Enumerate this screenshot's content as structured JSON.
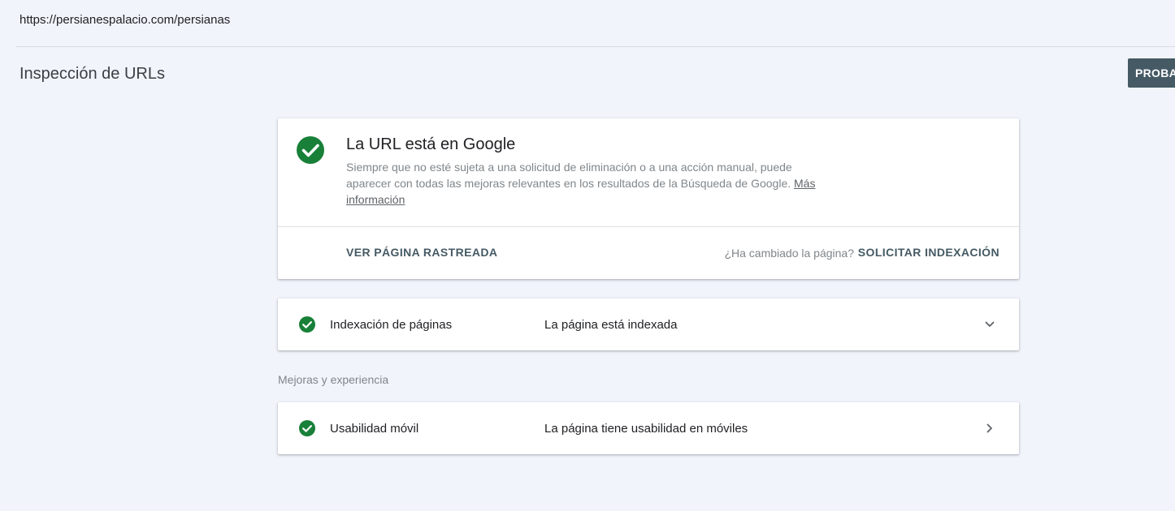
{
  "url_bar": {
    "url": "https://persianespalacio.com/persianas"
  },
  "header": {
    "title": "Inspección de URLs",
    "test_button_label": "PROBAR URL PUBLICADA"
  },
  "status_card": {
    "title": "La URL está en Google",
    "description": "Siempre que no esté sujeta a una solicitud de eliminación o a una acción manual, puede aparecer con todas las mejoras relevantes en los resultados de la Búsqueda de Google.",
    "learn_more": "Más información",
    "view_crawled": "VER PÁGINA RASTREADA",
    "changed_question": "¿Ha cambiado la página?",
    "request_indexing": "SOLICITAR INDEXACIÓN"
  },
  "indexing_row": {
    "label": "Indexación de páginas",
    "value": "La página está indexada",
    "icon": "chevron-down-icon"
  },
  "enhancements": {
    "section_label": "Mejoras y experiencia",
    "items": [
      {
        "label": "Usabilidad móvil",
        "value": "La página tiene usabilidad en móviles",
        "icon": "chevron-right-icon"
      }
    ]
  },
  "colors": {
    "success": "#188038",
    "button_bg": "#455a64",
    "page_bg": "#f1f4fb"
  }
}
